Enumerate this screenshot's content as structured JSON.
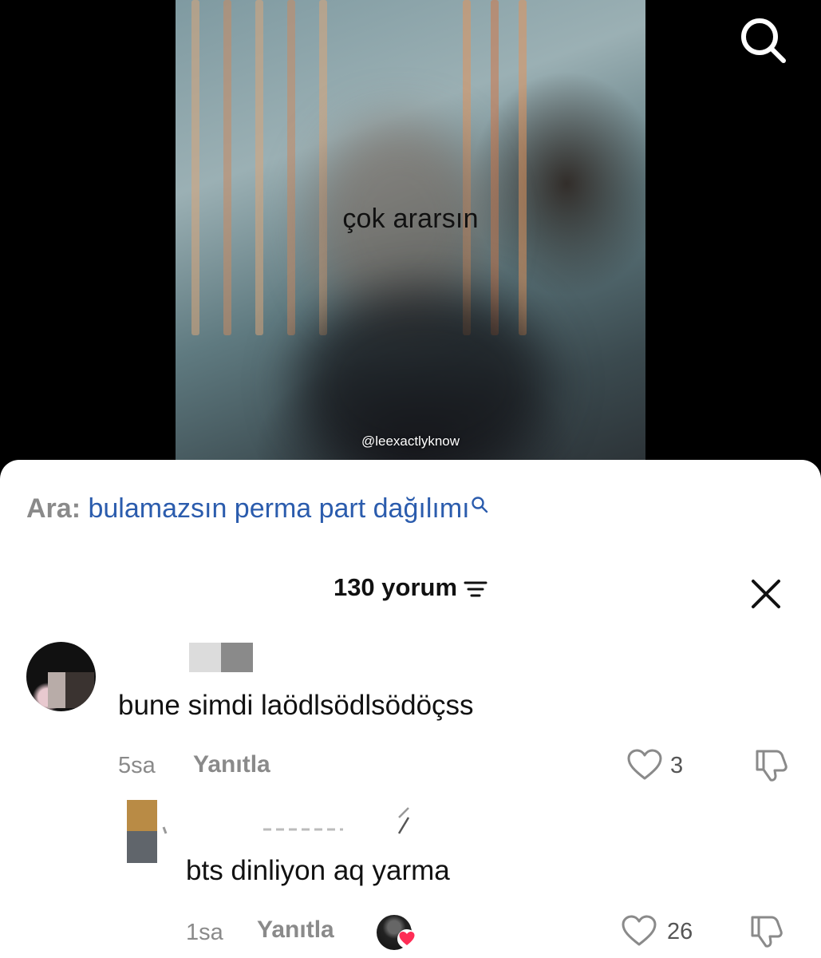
{
  "video": {
    "caption": "çok ararsın",
    "watermark": "@leexactlyknow"
  },
  "top_bar": {
    "search_icon": "search-icon"
  },
  "sheet": {
    "search_suggestion": {
      "prefix": "Ara:",
      "query": "bulamazsın perma part dağılımı"
    },
    "header": {
      "title": "130 yorum",
      "filter_icon": "filter-icon",
      "close_icon": "close-icon"
    },
    "comments": [
      {
        "text": "bune simdi laödlsödlsödöçss",
        "time": "5sa",
        "reply_label": "Yanıtla",
        "likes": "3"
      },
      {
        "text": "bts dinliyon aq yarma",
        "time": "1sa",
        "reply_label": "Yanıtla",
        "likes": "26"
      }
    ]
  },
  "colors": {
    "accent_link": "#2b5cad",
    "muted": "#8a8a8a",
    "heart": "#fe2c55"
  }
}
